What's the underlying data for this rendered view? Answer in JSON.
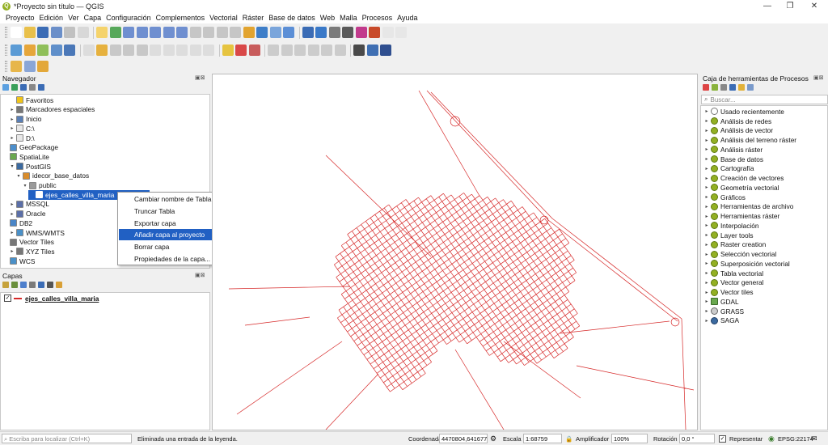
{
  "window": {
    "title": "*Proyecto sin título — QGIS",
    "icon_letter": "Q",
    "minimize": "—",
    "restore": "❐",
    "close": "✕"
  },
  "menu": [
    "Proyecto",
    "Edición",
    "Ver",
    "Capa",
    "Configuración",
    "Complementos",
    "Vectorial",
    "Ráster",
    "Base de datos",
    "Web",
    "Malla",
    "Procesos",
    "Ayuda"
  ],
  "navigator": {
    "title": "Navegador",
    "items": [
      {
        "label": "Favoritos",
        "icon": "star-icon",
        "color": "#f0c419"
      },
      {
        "label": "Marcadores espaciales",
        "icon": "bookmark-icon",
        "color": "#777777"
      },
      {
        "label": "Inicio",
        "icon": "home-icon",
        "color": "#5a7fb5"
      },
      {
        "label": "C:\\",
        "icon": "folder-icon",
        "color": "#e8e8e8"
      },
      {
        "label": "D:\\",
        "icon": "folder-icon",
        "color": "#e8e8e8"
      },
      {
        "label": "GeoPackage",
        "icon": "geopackage-icon",
        "color": "#4d8fcc"
      },
      {
        "label": "SpatiaLite",
        "icon": "spatialite-icon",
        "color": "#6aa84f"
      },
      {
        "label": "PostGIS",
        "icon": "postgis-icon",
        "color": "#3b6aa0"
      },
      {
        "label": "idecor_base_datos",
        "icon": "connection-icon",
        "color": "#d98c2b"
      },
      {
        "label": "public",
        "icon": "schema-icon",
        "color": "#9a9a9a"
      },
      {
        "label": "ejes_calles_villa_maria",
        "icon": "line-layer-icon",
        "color": "#ffffff"
      },
      {
        "label": "MSSQL",
        "icon": "mssql-icon",
        "color": "#5b6fa8"
      },
      {
        "label": "Oracle",
        "icon": "oracle-icon",
        "color": "#5b6fa8"
      },
      {
        "label": "DB2",
        "icon": "db2-icon",
        "color": "#4a86c8"
      },
      {
        "label": "WMS/WMTS",
        "icon": "wms-icon",
        "color": "#4a90c8"
      },
      {
        "label": "Vector Tiles",
        "icon": "vector-tiles-icon",
        "color": "#777777"
      },
      {
        "label": "XYZ Tiles",
        "icon": "xyz-tiles-icon",
        "color": "#777777"
      },
      {
        "label": "WCS",
        "icon": "wcs-icon",
        "color": "#4a90c8"
      }
    ]
  },
  "context_menu": {
    "items": [
      "Cambiar nombre de Tabla...",
      "Truncar Tabla",
      "Exportar capa",
      "Añadir capa al proyecto",
      "Borrar capa",
      "Propiedades de la capa..."
    ],
    "submenu_arrow": "▸",
    "active_index": 3
  },
  "layers": {
    "title": "Capas",
    "items": [
      {
        "label": "ejes_calles_villa_maria",
        "checked": "✓",
        "color": "#d62828"
      }
    ]
  },
  "processing": {
    "title": "Caja de herramientas de Procesos",
    "search_placeholder": "Buscar...",
    "items": [
      "Usado recientemente",
      "Análisis de redes",
      "Análisis de vector",
      "Análisis del terreno ráster",
      "Análisis ráster",
      "Base de datos",
      "Cartografía",
      "Creación de vectores",
      "Geometría vectorial",
      "Gráficos",
      "Herramientas de archivo",
      "Herramientas ráster",
      "Interpolación",
      "Layer tools",
      "Raster creation",
      "Selección vectorial",
      "Superposición vectorial",
      "Tabla vectorial",
      "Vector general",
      "Vector tiles",
      "GDAL",
      "GRASS",
      "SAGA"
    ]
  },
  "status": {
    "locator_placeholder": "Escriba para localizar (Ctrl+K)",
    "message": "Eliminada una entrada de la leyenda.",
    "coord_label": "Coordenada",
    "coord_value": "4470804,6416777",
    "scale_label": "Escala",
    "scale_value": "1:68759",
    "magnifier_label": "Amplificador",
    "magnifier_value": "100%",
    "rotation_label": "Rotación",
    "rotation_value": "0,0 °",
    "render_label": "Representar",
    "crs": "EPSG:22174"
  },
  "colors": {
    "accent": "#2160c3",
    "streets": "#d62828",
    "qgis_green": "#93b023"
  }
}
